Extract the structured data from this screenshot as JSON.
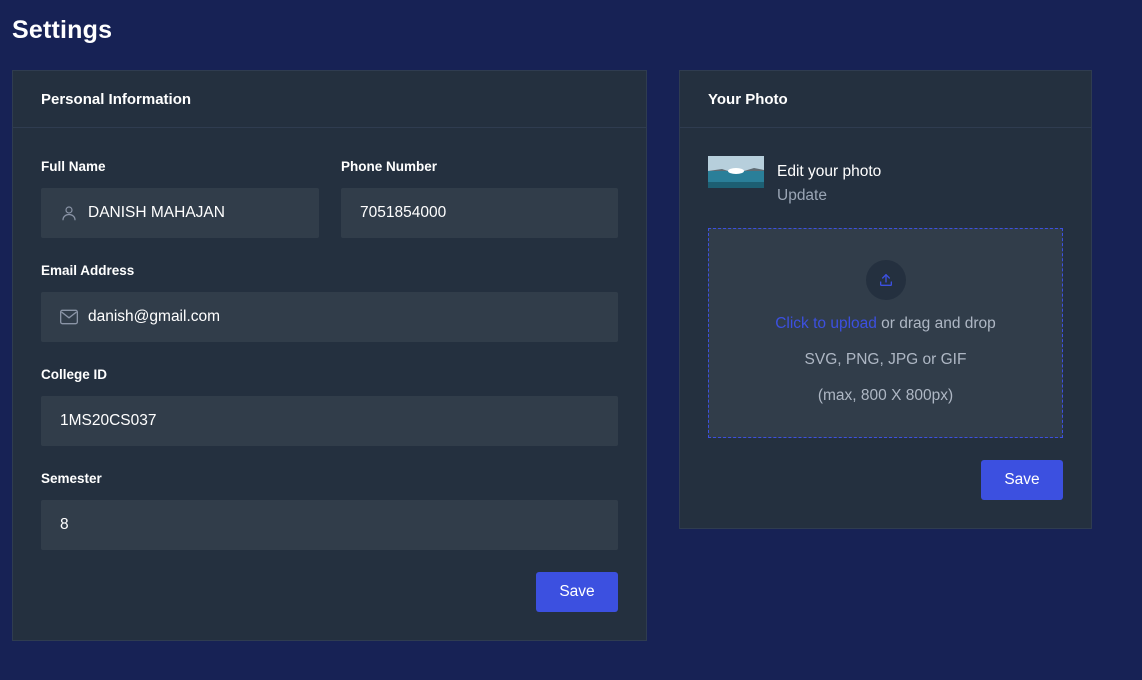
{
  "page": {
    "title": "Settings"
  },
  "personal": {
    "header": "Personal Information",
    "full_name": {
      "label": "Full Name",
      "value": "DANISH MAHAJAN",
      "icon": "user-icon"
    },
    "phone": {
      "label": "Phone Number",
      "value": "7051854000"
    },
    "email": {
      "label": "Email Address",
      "value": "danish@gmail.com",
      "icon": "mail-icon"
    },
    "college_id": {
      "label": "College ID",
      "value": "1MS20CS037"
    },
    "semester": {
      "label": "Semester",
      "value": "8"
    },
    "save_label": "Save"
  },
  "photo": {
    "header": "Your Photo",
    "edit_title": "Edit your photo",
    "edit_sub": "Update",
    "dropzone": {
      "icon": "upload-icon",
      "link_text": "Click to upload",
      "after_link": " or drag and drop",
      "formats": "SVG, PNG, JPG or GIF",
      "limits": "(max, 800 X 800px)"
    },
    "save_label": "Save"
  },
  "colors": {
    "page_bg": "#172255",
    "card_bg": "#24303f",
    "input_bg": "#313d4a",
    "accent": "#3c50e0",
    "muted_text": "#9aa5b5"
  }
}
